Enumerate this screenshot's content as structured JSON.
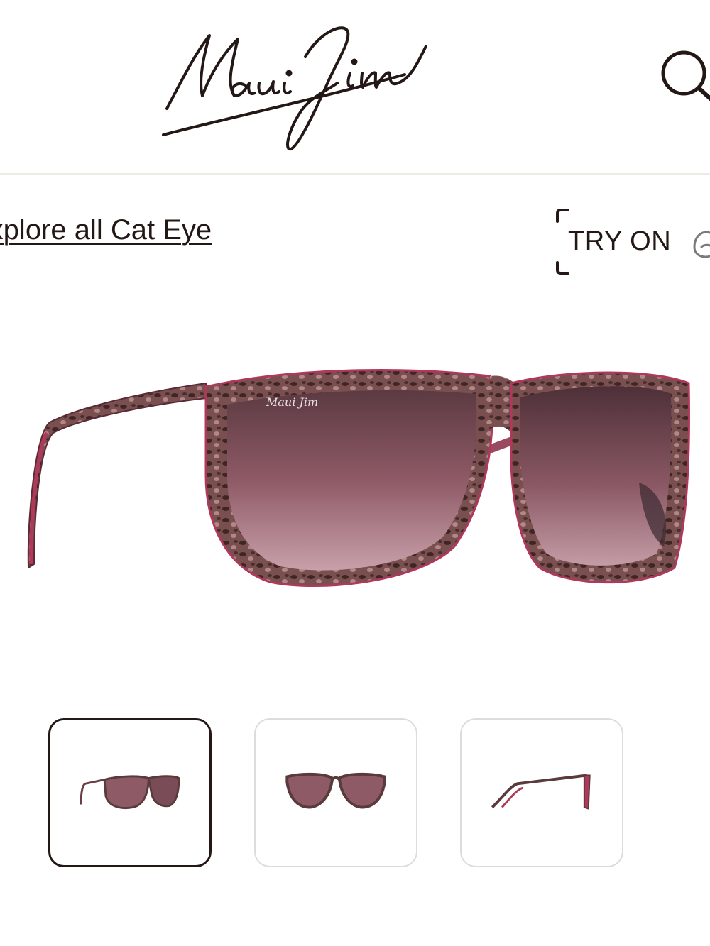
{
  "header": {
    "logo_text": "Maui Jim",
    "search_icon": "search-icon"
  },
  "nav": {
    "explore_label": "Explore all Cat Eye"
  },
  "try_on": {
    "label": "TRY ON",
    "icon": "ar-face-icon"
  },
  "product": {
    "main_image": "cat-eye-sunglasses-tortoise-rose-lens",
    "thumbnails": [
      {
        "view": "angled",
        "selected": true
      },
      {
        "view": "front",
        "selected": false
      },
      {
        "view": "side",
        "selected": false
      }
    ]
  },
  "colors": {
    "text": "#231815",
    "divider": "#ecebe6",
    "thumb_border": "#dcdcdc",
    "frame_tortoise": "#5a3a3a",
    "frame_pink": "#b0385a",
    "lens_rose": "#8e5a66"
  }
}
